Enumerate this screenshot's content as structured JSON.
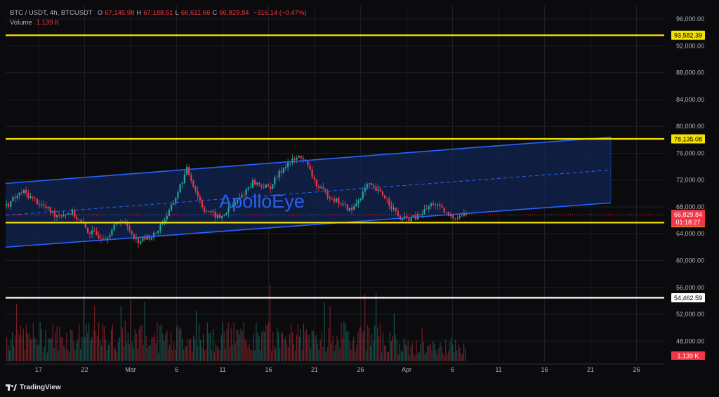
{
  "header": {
    "symbol": "BTC / USDT, 4h, BTCUSDT",
    "o_label": "O",
    "o_value": "67,145.98",
    "h_label": "H",
    "h_value": "67,188.51",
    "l_label": "L",
    "l_value": "66,611.66",
    "c_label": "C",
    "c_value": "66,829.84",
    "change": "−316.14 (−0.47%)",
    "volume_label": "Volume",
    "volume_value": "1.139 K"
  },
  "watermark": "ApolloEye",
  "brand": "TradingView",
  "colors": {
    "background": "#0b0b0d",
    "up": "#26a69a",
    "down": "#f23645",
    "level_yellow": "#f5e200",
    "level_white": "#ffffff",
    "channel": "#2962ff",
    "channel_fill": "#11224a",
    "price_tag": "#f23645"
  },
  "chart_data": {
    "type": "candlestick",
    "ylim": [
      45000,
      98000
    ],
    "y_ticks": [
      "96,000.00",
      "92,000.00",
      "88,000.00",
      "84,000.00",
      "80,000.00",
      "76,000.00",
      "72,000.00",
      "68,000.00",
      "64,000.00",
      "60,000.00",
      "56,000.00",
      "52,000.00",
      "48,000.00"
    ],
    "x_ticks": [
      "17",
      "22",
      "Mar",
      "6",
      "11",
      "16",
      "21",
      "26",
      "Apr",
      "6",
      "11",
      "16",
      "21",
      "26"
    ],
    "levels": [
      {
        "label": "93,582.39",
        "value": 93582.39,
        "color": "yellow"
      },
      {
        "label": "78,135.08",
        "value": 78135.08,
        "color": "yellow"
      },
      {
        "label": "65,655.95",
        "value": 65655.95,
        "color": "yellow"
      },
      {
        "label": "54,462.59",
        "value": 54462.59,
        "color": "white"
      }
    ],
    "last_price": {
      "label": "66,829.84",
      "countdown": "01:18:27",
      "value": 66829.84
    },
    "volume_tag": "1.139 K",
    "channel": {
      "upper": [
        [
          0,
          71500
        ],
        [
          1,
          78400
        ]
      ],
      "lower": [
        [
          0,
          62000
        ],
        [
          1,
          68600
        ]
      ],
      "middle": [
        [
          0,
          66750
        ],
        [
          1,
          73500
        ]
      ]
    },
    "price_path": [
      [
        "Feb 13",
        68200
      ],
      [
        "Feb 15",
        70300
      ],
      [
        "Feb 17",
        68500
      ],
      [
        "Feb 19",
        66800
      ],
      [
        "Feb 21",
        67200
      ],
      [
        "Feb 23",
        64300
      ],
      [
        "Feb 25",
        63400
      ],
      [
        "Feb 27",
        66200
      ],
      [
        "Feb 29",
        62900
      ],
      [
        "Mar 1",
        63800
      ],
      [
        "Mar 3",
        67600
      ],
      [
        "Mar 5",
        73600
      ],
      [
        "Mar 7",
        67700
      ],
      [
        "Mar 9",
        66300
      ],
      [
        "Mar 11",
        68700
      ],
      [
        "Mar 13",
        71700
      ],
      [
        "Mar 15",
        70800
      ],
      [
        "Mar 17",
        74300
      ],
      [
        "Mar 18",
        75600
      ],
      [
        "Mar 20",
        70800
      ],
      [
        "Mar 22",
        69100
      ],
      [
        "Mar 24",
        67400
      ],
      [
        "Mar 26",
        71300
      ],
      [
        "Mar 28",
        69700
      ],
      [
        "Mar 30",
        66100
      ],
      [
        "Apr 1",
        66400
      ],
      [
        "Apr 3",
        68600
      ],
      [
        "Apr 5",
        66500
      ],
      [
        "Apr 7",
        66829.84
      ]
    ]
  }
}
